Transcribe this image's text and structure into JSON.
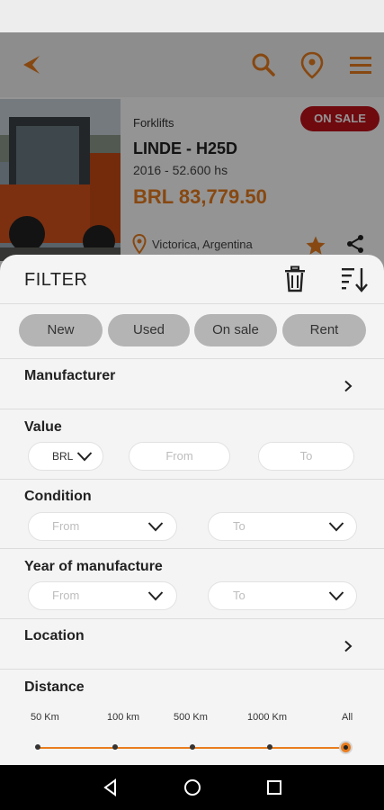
{
  "listing": {
    "category": "Forklifts",
    "badge": "ON SALE",
    "model": "LINDE - H25D",
    "year_hours": "2016 - 52.600 hs",
    "price": "BRL 83,779.50",
    "location": "Victorica, Argentina"
  },
  "filter": {
    "title": "FILTER",
    "chips": [
      "New",
      "Used",
      "On sale",
      "Rent"
    ],
    "manufacturer_label": "Manufacturer",
    "value_label": "Value",
    "currency": "BRL",
    "value_from_placeholder": "From",
    "value_to_placeholder": "To",
    "condition_label": "Condition",
    "condition_from": "From",
    "condition_to": "To",
    "year_label": "Year of manufacture",
    "year_from": "From",
    "year_to": "To",
    "location_label": "Location",
    "distance_label": "Distance",
    "distance_steps": [
      "50 Km",
      "100 km",
      "500 Km",
      "1000 Km",
      "All"
    ],
    "distance_selected_index": 4
  },
  "colors": {
    "accent": "#e87d1e",
    "badge": "#c0121a",
    "chip": "#b4b4b4"
  }
}
